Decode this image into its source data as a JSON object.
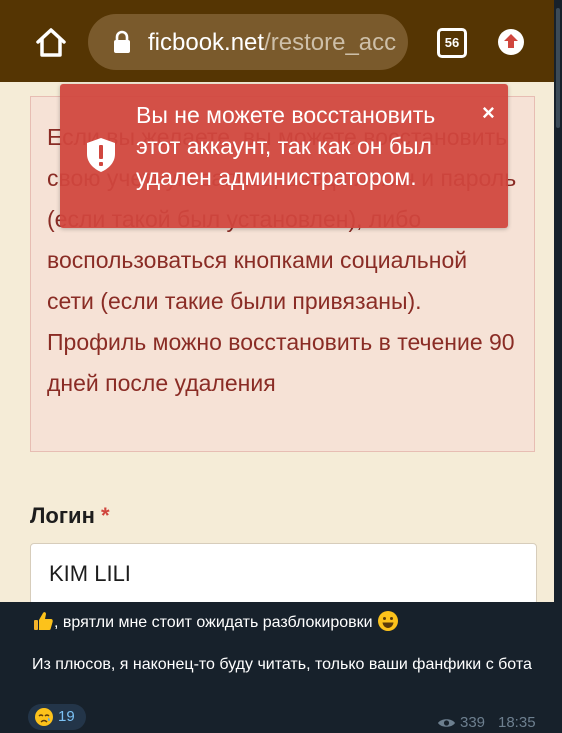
{
  "browser": {
    "url_domain": "ficbook.net",
    "url_path": "/restore_acc",
    "tab_count": "56",
    "icons": {
      "home": "home-icon",
      "lock": "lock-icon",
      "upload": "upload-icon"
    }
  },
  "page": {
    "info_text": "Если вы желаете, вы можете восстановить свою учетную запись, введя логин и пароль (если такой был установлен), либо воспользоваться кнопками социальной сети (если такие были привязаны). Профиль можно восстановить в течение 90 дней после удаления",
    "login_label": "Логин",
    "required_mark": "*",
    "login_value": "KIM LILI"
  },
  "toast": {
    "message": "Вы не можете восстановить этот аккаунт, так как он был удален администратором.",
    "close_glyph": "×",
    "icon": "shield-warning-icon"
  },
  "message": {
    "line1": ", врятли мне стоит ожидать разблокировки",
    "line2": "Из плюсов, я наконец-то буду читать, только ваши фанфики с бота",
    "reaction_count": "19",
    "views": "339",
    "time": "18:35"
  },
  "colors": {
    "browser_bar": "#553503",
    "toast": "#d0463e",
    "chat_bg": "#17212b",
    "reaction_text": "#7cc2f5"
  }
}
